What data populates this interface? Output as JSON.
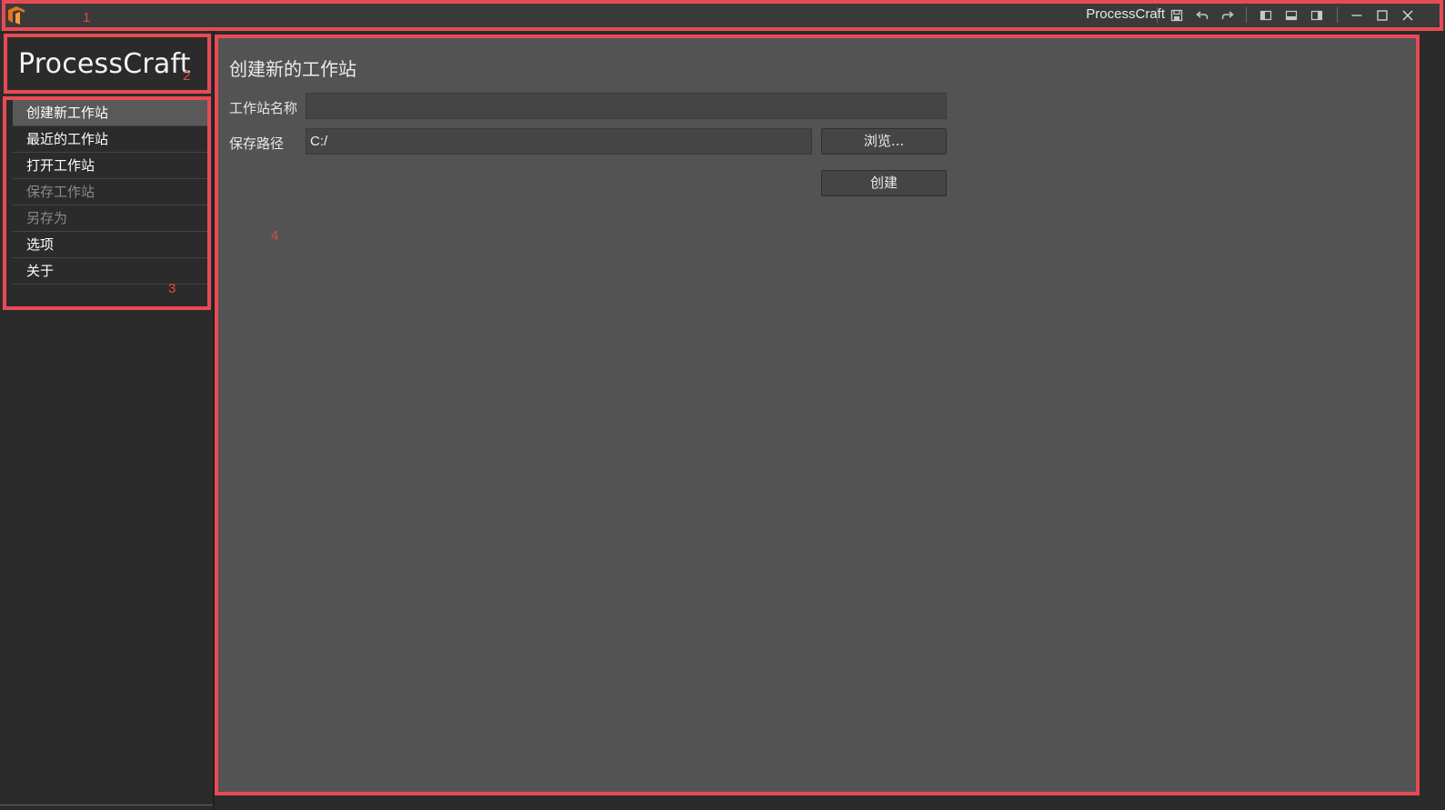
{
  "titlebar": {
    "marker": "1",
    "app_title": "ProcessCraft",
    "icons": [
      "save-icon",
      "undo-icon",
      "redo-icon",
      "layout-left-icon",
      "layout-bottom-icon",
      "layout-right-icon",
      "minimize-icon",
      "maximize-icon",
      "close-icon"
    ]
  },
  "sidebar": {
    "brand": "ProcessCraft",
    "brand_marker": "2",
    "nav_marker": "3",
    "items": [
      {
        "label": "创建新工作站",
        "state": "active"
      },
      {
        "label": "最近的工作站",
        "state": "normal"
      },
      {
        "label": "打开工作站",
        "state": "normal"
      },
      {
        "label": "保存工作站",
        "state": "disabled"
      },
      {
        "label": "另存为",
        "state": "disabled"
      },
      {
        "label": "选项",
        "state": "normal"
      },
      {
        "label": "关于",
        "state": "normal"
      }
    ]
  },
  "main": {
    "marker": "4",
    "title": "创建新的工作站",
    "name_label": "工作站名称",
    "name_value": "",
    "path_label": "保存路径",
    "path_value": "C:/",
    "browse_label": "浏览...",
    "create_label": "创建"
  },
  "colors": {
    "annotation_red": "#e84a55",
    "logo_orange": "#e8731a"
  }
}
